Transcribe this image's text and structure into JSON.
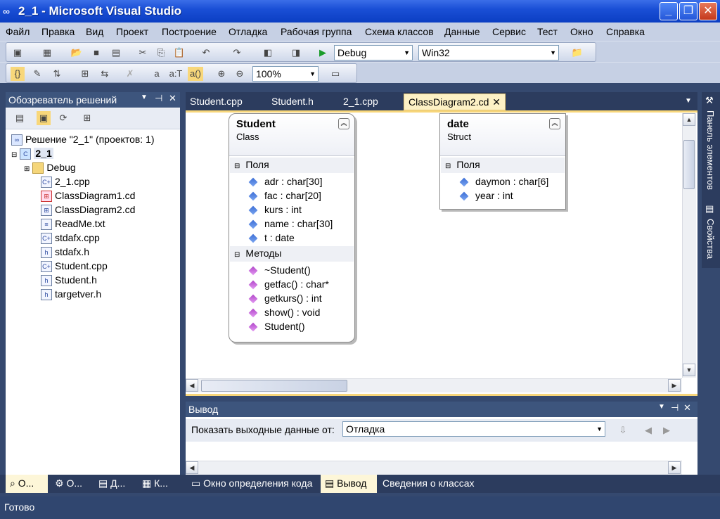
{
  "window": {
    "title": "2_1 - Microsoft Visual Studio",
    "controls": {
      "minimize": "_",
      "maximize": "❐",
      "close": "✕"
    }
  },
  "menu": [
    "Файл",
    "Правка",
    "Вид",
    "Проект",
    "Построение",
    "Отладка",
    "Рабочая группа",
    "Схема классов",
    "Данные",
    "Сервис",
    "Тест",
    "Окно",
    "Справка"
  ],
  "toolbar": {
    "configuration": "Debug",
    "platform": "Win32",
    "zoom": "100%",
    "text_buttons": {
      "a": "a",
      "aT": "a:T",
      "a_paren": "a()"
    }
  },
  "solution_explorer": {
    "title": "Обозреватель решений",
    "solution": "Решение \"2_1\"  (проектов: 1)",
    "project": "2_1",
    "items": [
      "Debug",
      "2_1.cpp",
      "ClassDiagram1.cd",
      "ClassDiagram2.cd",
      "ReadMe.txt",
      "stdafx.cpp",
      "stdafx.h",
      "Student.cpp",
      "Student.h",
      "targetver.h"
    ]
  },
  "document_tabs": [
    "Student.cpp",
    "Student.h",
    "2_1.cpp",
    "ClassDiagram2.cd"
  ],
  "active_tab": "ClassDiagram2.cd",
  "diagram": {
    "student": {
      "name": "Student",
      "kind": "Class",
      "fields_label": "Поля",
      "fields": [
        "adr : char[30]",
        "fac : char[20]",
        "kurs : int",
        "name : char[30]",
        "t : date"
      ],
      "methods_label": "Методы",
      "methods": [
        "~Student()",
        "getfac() : char*",
        "getkurs() : int",
        "show() : void",
        "Student()"
      ]
    },
    "date": {
      "name": "date",
      "kind": "Struct",
      "fields_label": "Поля",
      "fields": [
        "daymon : char[6]",
        "year : int"
      ]
    }
  },
  "side_panels": [
    "Панель элементов",
    "Свойства"
  ],
  "output": {
    "title": "Вывод",
    "show_from_label": "Показать выходные данные от:",
    "source": "Отладка"
  },
  "bottom_tabs": [
    "О...",
    "О...",
    "Д...",
    "К...",
    "Окно определения кода",
    "Вывод",
    "Сведения о классах"
  ],
  "status": "Готово"
}
